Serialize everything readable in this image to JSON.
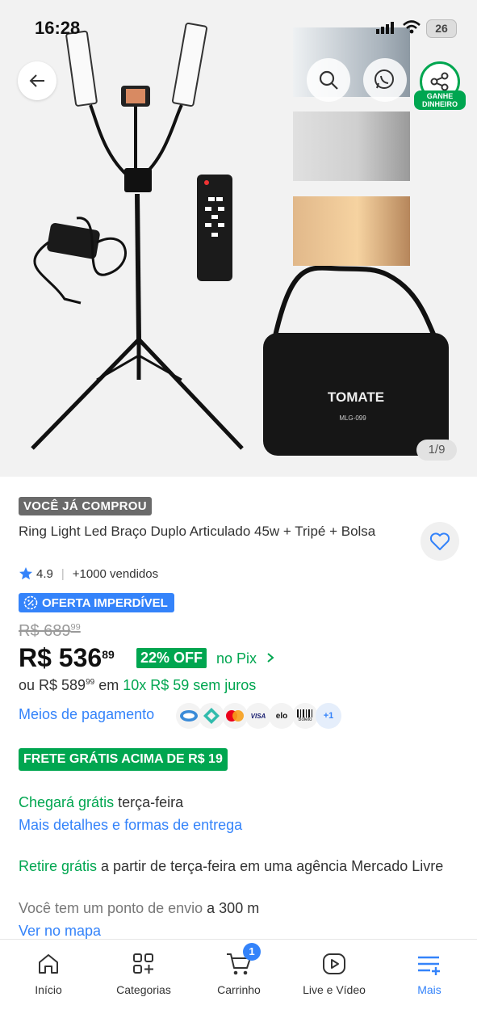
{
  "status_bar": {
    "time": "16:28",
    "battery": "26"
  },
  "gallery": {
    "pager": "1/9",
    "share_caption": "GANHE DINHEIRO",
    "bag_brand": "TOMATE",
    "bag_model": "MLG-099"
  },
  "product": {
    "purchased_badge": "VOCÊ JÁ COMPROU",
    "title": " Ring Light Led  Braço Duplo Articulado 45w + Tripé + Bolsa",
    "rating": "4.9",
    "sold": "+1000 vendidos",
    "deal_badge": "OFERTA IMPERDÍVEL",
    "old_price_main": "R$ 689",
    "old_price_cents": "99",
    "price_main": "R$ 536",
    "price_cents": "89",
    "discount": "22% OFF",
    "pix_label": "no Pix",
    "installment_prefix": "ou R$ 589",
    "installment_cents": "99",
    "installment_in": " em ",
    "installment_plan": "10x R$ 59 sem juros",
    "payment_methods_link": "Meios de pagamento",
    "payment_more": "+1",
    "payment_labels": {
      "visa": "VISA",
      "elo": "elo",
      "boleto": "Boleto"
    }
  },
  "shipping": {
    "free_badge": "FRETE GRÁTIS ACIMA DE R$ 19",
    "arrives_green": "Chegará grátis",
    "arrives_rest": " terça-feira",
    "details_link": "Mais detalhes e formas de entrega",
    "pickup_green": "Retire grátis",
    "pickup_rest": " a partir de terça-feira em uma agência Mercado Livre",
    "point_grey": "Você tem um ponto de envio",
    "point_dist": " a 300 m",
    "map_link": "Ver no mapa"
  },
  "tabbar": {
    "home": "Início",
    "categories": "Categorias",
    "cart": "Carrinho",
    "cart_count": "1",
    "live": "Live e Vídeo",
    "more": "Mais"
  },
  "colors": {
    "accent": "#3483fa",
    "green": "#00a650"
  }
}
